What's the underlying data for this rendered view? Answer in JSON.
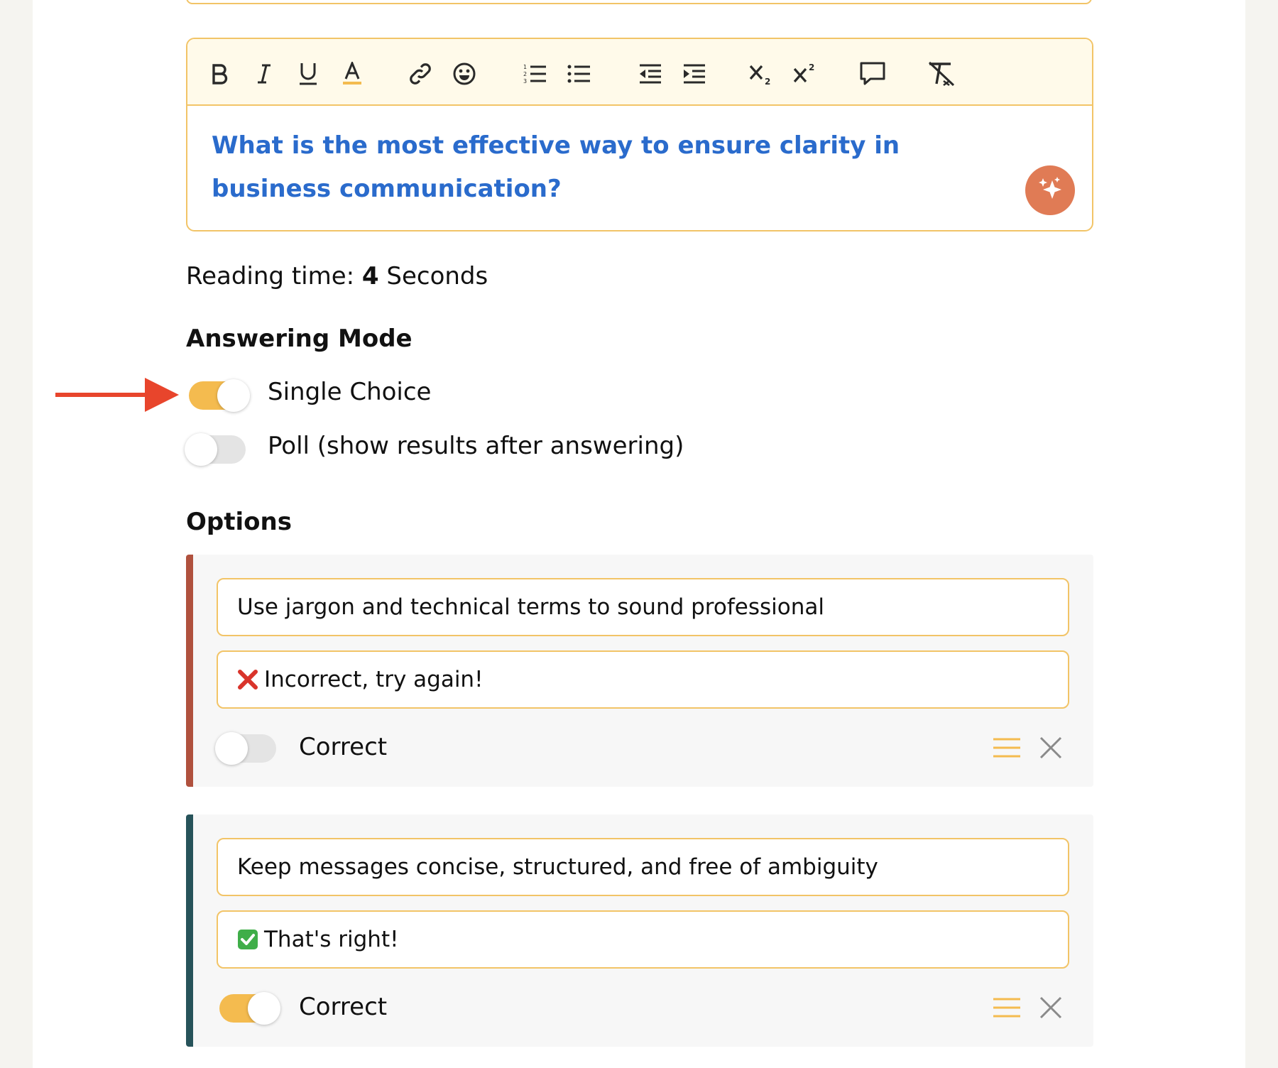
{
  "editor": {
    "toolbar": {
      "buttons": [
        "bold-icon",
        "italic-icon",
        "underline-icon",
        "font-color-icon",
        "link-icon",
        "emoji-icon",
        "numbered-list-icon",
        "bulleted-list-icon",
        "outdent-icon",
        "indent-icon",
        "subscript-icon",
        "superscript-icon",
        "comment-icon",
        "clear-format-icon"
      ]
    },
    "question": "What is the most effective way to ensure clarity in business communication?",
    "ai_button_icon": "sparkle-icon"
  },
  "reading_time": {
    "label": "Reading time:",
    "value": "4",
    "unit": "Seconds"
  },
  "answering_mode": {
    "heading": "Answering Mode",
    "options": [
      {
        "label": "Single Choice",
        "enabled": true
      },
      {
        "label": "Poll (show results after answering)",
        "enabled": false
      }
    ]
  },
  "options": {
    "heading": "Options",
    "items": [
      {
        "text": "Use jargon and technical terms to sound professional",
        "feedback": "Incorrect, try again!",
        "feedback_icon": "cross-mark-icon",
        "correct_label": "Correct",
        "correct": false,
        "accent": "#b0513e"
      },
      {
        "text": "Keep messages concise, structured, and free of ambiguity",
        "feedback": "That's right!",
        "feedback_icon": "check-mark-icon",
        "correct_label": "Correct",
        "correct": true,
        "accent": "#27535a"
      }
    ]
  },
  "colors": {
    "accent_orange": "#f4bb4f",
    "border": "#f2c467",
    "question_blue": "#2a6bcc",
    "ai_button": "#e07b55",
    "annotation_arrow": "#e8452c"
  }
}
